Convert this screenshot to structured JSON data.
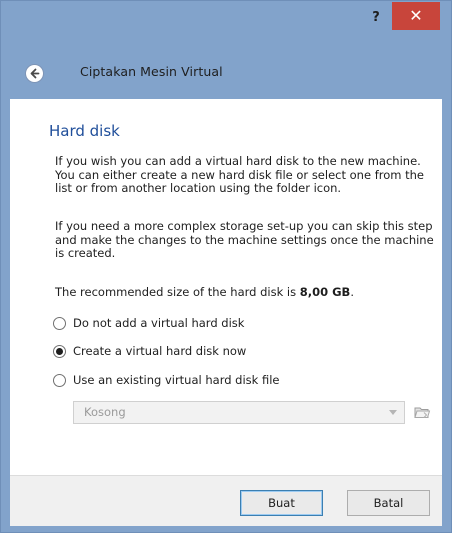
{
  "titlebar": {
    "help_label": "?",
    "close_label": "✕"
  },
  "header": {
    "title": "Ciptakan Mesin Virtual"
  },
  "page": {
    "title": "Hard disk",
    "paragraph1": "If you wish you can add a virtual hard disk to the new machine. You can either create a new hard disk file or select one from the list or from another location using the folder icon.",
    "paragraph2": "If you need a more complex storage set-up you can skip this step and make the changes to the machine settings once the machine is created.",
    "recommended_prefix": "The recommended size of the hard disk is ",
    "recommended_size": "8,00 GB",
    "recommended_suffix": "."
  },
  "options": [
    {
      "label": "Do not add a virtual hard disk",
      "selected": false
    },
    {
      "label": "Create a virtual hard disk now",
      "selected": true
    },
    {
      "label": "Use an existing virtual hard disk file",
      "selected": false
    }
  ],
  "disk_select": {
    "value": "Kosong",
    "enabled": false
  },
  "icons": {
    "back": "back-arrow-icon",
    "dropdown": "chevron-down-icon",
    "folder": "folder-icon"
  },
  "buttons": {
    "create": "Buat",
    "cancel": "Batal"
  },
  "colors": {
    "frame": "#82a3cb",
    "close": "#c8453b",
    "title_blue": "#1f4e9a"
  }
}
